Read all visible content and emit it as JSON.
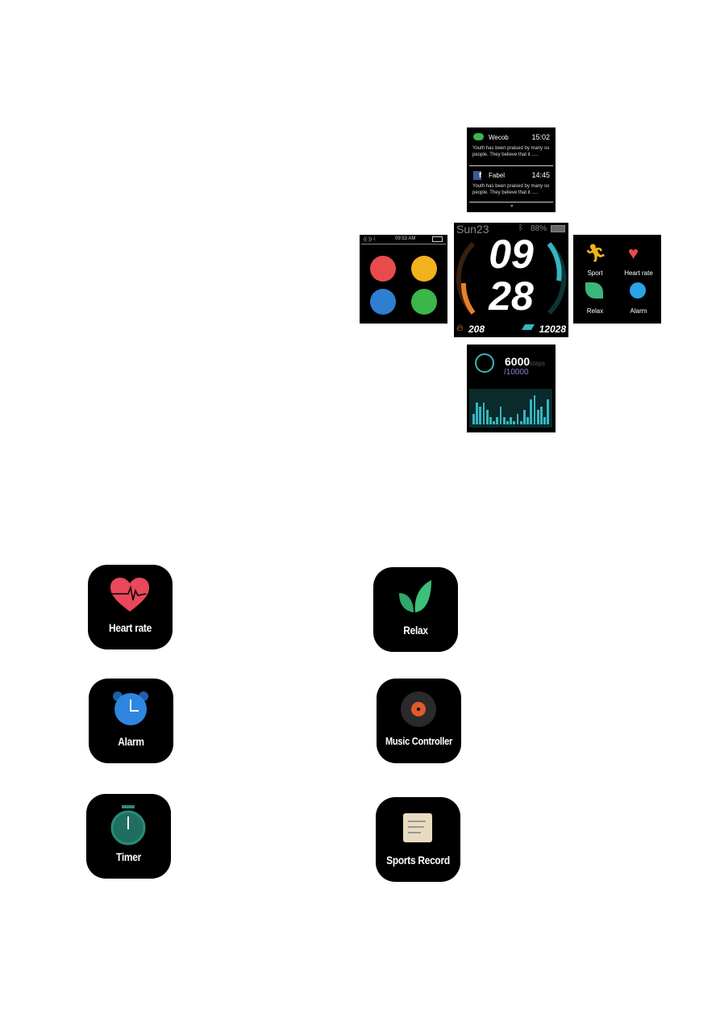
{
  "notifications": {
    "items": [
      {
        "app": "Wecob",
        "time": "15:02",
        "text": "Youth has been praised by many so people. They believe that it .....",
        "icon": "wechat-icon"
      },
      {
        "app": "Fabel",
        "time": "14:45",
        "text": "Youth has been praised by many so people. They believe that it .....",
        "icon": "facebook-icon"
      }
    ],
    "more_glyph": "»"
  },
  "quick_panel": {
    "status_time": "09:53 AM",
    "buttons": [
      "heart-rate-icon",
      "find-phone-icon",
      "sleep-icon",
      "phone-icon"
    ],
    "colors": [
      "#e84b4b",
      "#f2b21d",
      "#2f7fd0",
      "#3cb54a"
    ]
  },
  "watch_face": {
    "date": "Sun23",
    "battery": "88%",
    "hour": "09",
    "minute": "28",
    "calories": "208",
    "steps": "12028",
    "accent_left": "#e8802a",
    "accent_right": "#35b5c0"
  },
  "app_menu": {
    "items": [
      "Sport",
      "Heart rate",
      "Relax",
      "Alarm"
    ]
  },
  "steps_screen": {
    "steps": "6000",
    "unit": "steps",
    "goal": "/10000",
    "bars": [
      3,
      6,
      5,
      6,
      4,
      2,
      1,
      2,
      5,
      2,
      1,
      2,
      1,
      3,
      1,
      4,
      2,
      7,
      8,
      4,
      5,
      2,
      7
    ]
  },
  "tiles": [
    {
      "label": "Heart rate",
      "icon": "heart-rate-icon"
    },
    {
      "label": "Relax",
      "icon": "leaf-icon"
    },
    {
      "label": "Alarm",
      "icon": "alarm-clock-icon"
    },
    {
      "label": "Music Controller",
      "icon": "vinyl-record-icon"
    },
    {
      "label": "Timer",
      "icon": "stopwatch-icon"
    },
    {
      "label": "Sports Record",
      "icon": "notepad-icon"
    }
  ]
}
